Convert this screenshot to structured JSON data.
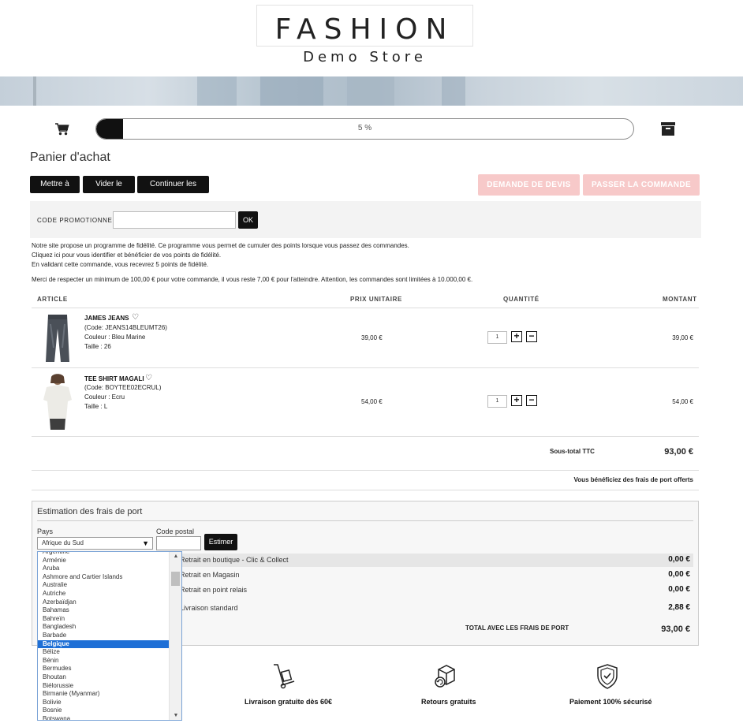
{
  "header": {
    "logo_main": "FASHION",
    "logo_sub": "Demo Store"
  },
  "progress": {
    "value_percent": 5,
    "label": "5 %"
  },
  "page_title": "Panier d'achat",
  "actions": {
    "update": "Mettre à jour",
    "empty": "Vider le panier",
    "continue": "Continuer les achats",
    "quote": "DEMANDE DE DEVIS",
    "checkout": "PASSER LA COMMANDE"
  },
  "promo": {
    "label": "CODE PROMOTIONNEL :",
    "value": "",
    "ok": "OK"
  },
  "info": {
    "line1": "Notre site propose un programme de fidélité. Ce programme vous permet de cumuler des points lorsque vous passez des commandes.",
    "line2": "Cliquez ici pour vous identifier et bénéficier de vos points de fidélité.",
    "line3": "En validant cette commande, vous recevrez 5 points de fidélité.",
    "line4": "Merci de respecter un minimum de 100,00 € pour votre commande, il vous reste 7,00 € pour l'atteindre. Attention, les commandes sont limitées à 10.000,00 €."
  },
  "table": {
    "headers": {
      "article": "ARTICLE",
      "unit_price": "PRIX UNITAIRE",
      "quantity": "QUANTITÉ",
      "amount": "MONTANT"
    },
    "rows": [
      {
        "name": "JAMES JEANS",
        "code": "(Code: JEANS14BLEUMT26)",
        "color": "Couleur : Bleu Marine",
        "size": "Taille : 26",
        "price": "39,00 €",
        "qty": "1",
        "amount": "39,00 €"
      },
      {
        "name": "TEE SHIRT MAGALI",
        "code": "(Code: BOYTEE02ECRUL)",
        "color": "Couleur : Ecru",
        "size": "Taille : L",
        "price": "54,00 €",
        "qty": "1",
        "amount": "54,00 €"
      }
    ]
  },
  "subtotal": {
    "label": "Sous-total TTC",
    "value": "93,00 €"
  },
  "free_shipping": "Vous bénéficiez des frais de port offerts",
  "shipping": {
    "title": "Estimation des frais de port",
    "country_label": "Pays",
    "country_value": "Afrique du Sud",
    "postal_label": "Code postal",
    "postal_value": "",
    "estimate": "Estimer",
    "options": [
      {
        "name": "Retrait en boutique - Clic & Collect",
        "value": "0,00 €"
      },
      {
        "name": "Retrait en Magasin",
        "value": "0,00 €"
      },
      {
        "name": "Retrait en point relais",
        "value": "0,00 €"
      },
      {
        "name": "Livraison standard",
        "value": "2,88 €"
      }
    ],
    "total_label": "TOTAL AVEC LES FRAIS DE PORT",
    "total_value": "93,00 €"
  },
  "country_dropdown": {
    "items": [
      "Argentine",
      "Arménie",
      "Aruba",
      "Ashmore and Cartier Islands",
      "Australie",
      "Autriche",
      "Azerbaïdjan",
      "Bahamas",
      "Bahreïn",
      "Bangladesh",
      "Barbade",
      "Belgique",
      "Bélize",
      "Bénin",
      "Bermudes",
      "Bhoutan",
      "Biélorussie",
      "Birmanie (Myanmar)",
      "Bolivie",
      "Bosnie",
      "Botswana"
    ],
    "selected": "Belgique"
  },
  "features": {
    "delivery": "Livraison gratuite dès 60€",
    "returns": "Retours gratuits",
    "payment": "Paiement 100% sécurisé"
  },
  "icons": [
    "cart-icon",
    "archive-icon",
    "heart-icon",
    "plus-icon",
    "minus-icon",
    "dolly-icon",
    "returns-box-icon",
    "shield-check-icon"
  ]
}
